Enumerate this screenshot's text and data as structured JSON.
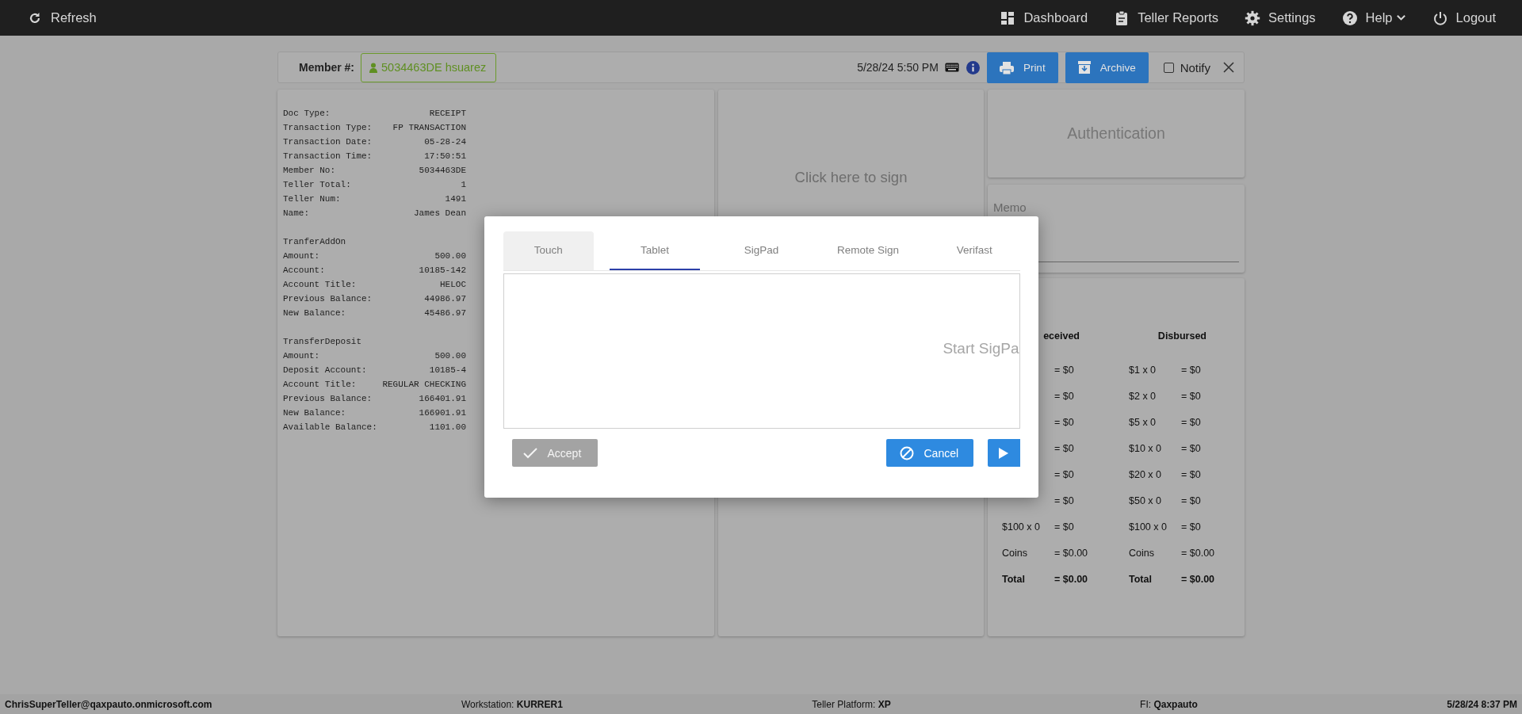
{
  "topbar": {
    "left": [
      {
        "label": "Refresh",
        "dropdown": false
      }
    ],
    "right": [
      {
        "label": "Dashboard",
        "dropdown": false
      },
      {
        "label": "Teller Reports",
        "dropdown": false
      },
      {
        "label": "Settings",
        "dropdown": false
      },
      {
        "label": "Help",
        "dropdown": true
      },
      {
        "label": "Logout",
        "dropdown": false
      }
    ]
  },
  "member_bar": {
    "label": "Member #:",
    "member": "5034463DE hsuarez",
    "datetime": "5/28/24 5:50 PM",
    "buttons": [
      "Print",
      "Archive"
    ],
    "notify": {
      "label": "Notify",
      "checked": false
    }
  },
  "receipt": {
    "sections": [
      {
        "rows": [
          {
            "label": "Doc Type:",
            "value": "RECEIPT"
          },
          {
            "label": "Transaction Type:",
            "value": "FP TRANSACTION"
          },
          {
            "label": "Transaction Date:",
            "value": "05-28-24"
          },
          {
            "label": "Transaction Time:",
            "value": "17:50:51"
          },
          {
            "label": "Member No:",
            "value": "5034463DE"
          },
          {
            "label": "Teller Total:",
            "value": "1"
          },
          {
            "label": "Teller Num:",
            "value": "1491"
          },
          {
            "label": "Name:",
            "value": "James Dean"
          }
        ]
      },
      {
        "heading": "TranferAddOn",
        "rows": [
          {
            "label": "Amount:",
            "value": "500.00"
          },
          {
            "label": "Account:",
            "value": "10185-142"
          },
          {
            "label": "Account Title:",
            "value": "HELOC"
          },
          {
            "label": "Previous Balance:",
            "value": "44986.97"
          },
          {
            "label": "New Balance:",
            "value": "45486.97"
          }
        ]
      },
      {
        "heading": "TransferDeposit",
        "rows": [
          {
            "label": "Amount:",
            "value": "500.00"
          },
          {
            "label": "Deposit Account:",
            "value": "10185-4"
          },
          {
            "label": "Account Title:",
            "value": "REGULAR CHECKING"
          },
          {
            "label": "Previous Balance:",
            "value": "166401.91"
          },
          {
            "label": "New Balance:",
            "value": "166901.91"
          },
          {
            "label": "Available Balance:",
            "value": "1101.00"
          }
        ]
      }
    ]
  },
  "signature_panel": {
    "prompt": "Click here to sign"
  },
  "authentication": {
    "label": "Authentication"
  },
  "memo": {
    "label": "Memo"
  },
  "cash": {
    "columns": [
      {
        "header": "eceived",
        "rows": [
          {
            "value": "= $0"
          },
          {
            "value": "= $0"
          },
          {
            "value": "= $0"
          },
          {
            "value": "= $0"
          },
          {
            "value": "= $0"
          },
          {
            "value": "= $0"
          },
          {
            "label": "$100 x 0",
            "value": "= $0",
            "kind": "line"
          },
          {
            "label": "Coins",
            "value": "= $0.00",
            "kind": "line"
          },
          {
            "label": "Total",
            "value": "= $0.00",
            "kind": "total"
          }
        ]
      },
      {
        "header": "Disbursed",
        "rows": [
          {
            "label": "$1 x 0",
            "value": "= $0",
            "kind": "line"
          },
          {
            "label": "$2 x 0",
            "value": "= $0",
            "kind": "line"
          },
          {
            "label": "$5 x 0",
            "value": "= $0",
            "kind": "line"
          },
          {
            "label": "$10 x 0",
            "value": "= $0",
            "kind": "line"
          },
          {
            "label": "$20 x 0",
            "value": "= $0",
            "kind": "line"
          },
          {
            "label": "$50 x 0",
            "value": "= $0",
            "kind": "line"
          },
          {
            "label": "$100 x 0",
            "value": "= $0",
            "kind": "line"
          },
          {
            "label": "Coins",
            "value": "= $0.00",
            "kind": "line"
          },
          {
            "label": "Total",
            "value": "= $0.00",
            "kind": "total"
          }
        ]
      }
    ]
  },
  "modal": {
    "tabs": [
      {
        "label": "Touch",
        "selected": false,
        "hovered": true
      },
      {
        "label": "Tablet",
        "selected": true,
        "hovered": false
      },
      {
        "label": "SigPad",
        "selected": false,
        "hovered": false
      },
      {
        "label": "Remote Sign",
        "selected": false,
        "hovered": false
      },
      {
        "label": "Verifast",
        "selected": false,
        "hovered": false
      }
    ],
    "canvas_hint": "Start SigPa",
    "buttons": [
      {
        "kind": "accept",
        "label": "Accept",
        "disabled": true
      },
      {
        "kind": "cancel",
        "label": "Cancel",
        "disabled": false
      },
      {
        "kind": "next",
        "disabled": false
      }
    ]
  },
  "status_bar": [
    {
      "text": "ChrisSuperTeller@qaxpauto.onmicrosoft.com",
      "bold": true
    },
    {
      "text": "Workstation: **KURRER1**",
      "bold": false
    },
    {
      "text": "Teller Platform: **XP**",
      "bold": false
    },
    {
      "text": "FI: **Qaxpauto**",
      "bold": false
    },
    {
      "text": "5/28/24 8:37 PM",
      "bold": true
    }
  ]
}
